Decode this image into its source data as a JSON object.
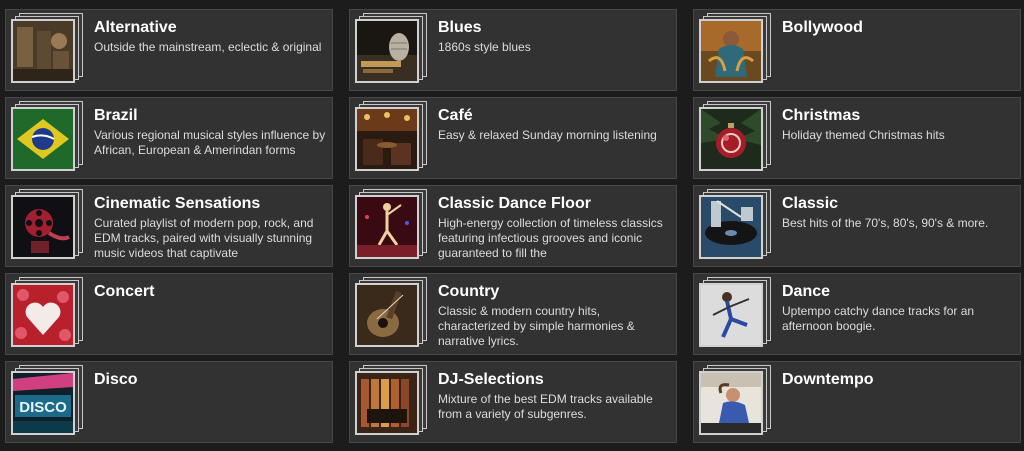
{
  "genres": [
    {
      "title": "Alternative",
      "desc": "Outside the mainstream, eclectic & original",
      "icon": "alternative-art-icon"
    },
    {
      "title": "Blues",
      "desc": "1860s style blues",
      "icon": "microphone-art-icon"
    },
    {
      "title": "Bollywood",
      "desc": "",
      "icon": "dancer-art-icon"
    },
    {
      "title": "Brazil",
      "desc": "Various regional musical styles influence by African, European & Amerindan forms",
      "icon": "brazil-flag-art-icon"
    },
    {
      "title": "Café",
      "desc": "Easy & relaxed Sunday morning listening",
      "icon": "cafe-art-icon"
    },
    {
      "title": "Christmas",
      "desc": "Holiday themed Christmas hits",
      "icon": "ornament-art-icon"
    },
    {
      "title": "Cinematic Sensations",
      "desc": "Curated playlist of modern pop, rock, and EDM tracks, paired with visually stunning music videos that captivate",
      "icon": "film-reel-art-icon"
    },
    {
      "title": "Classic Dance Floor",
      "desc": "High-energy collection of timeless classics featuring infectious grooves and iconic guaranteed to fill the",
      "icon": "dance-floor-art-icon"
    },
    {
      "title": "Classic",
      "desc": "Best hits of the 70's, 80's, 90's & more.",
      "icon": "turntable-art-icon"
    },
    {
      "title": "Concert",
      "desc": "",
      "icon": "heart-roses-art-icon"
    },
    {
      "title": "Country",
      "desc": "Classic & modern country hits, characterized by simple harmonies & narrative lyrics.",
      "icon": "guitar-art-icon"
    },
    {
      "title": "Dance",
      "desc": "Uptempo catchy dance tracks for an afternoon boogie.",
      "icon": "dancer-jump-art-icon"
    },
    {
      "title": "Disco",
      "desc": "",
      "icon": "disco-sign-art-icon"
    },
    {
      "title": "DJ-Selections",
      "desc": "Mixture of the best EDM tracks available from a variety of subgenres.",
      "icon": "dj-art-icon"
    },
    {
      "title": "Downtempo",
      "desc": "",
      "icon": "relaxing-woman-art-icon"
    }
  ],
  "colors": {
    "background": "#1c1c1c",
    "tile": "#323232",
    "tile_border": "#474747",
    "title": "#ffffff",
    "desc": "#dcdcdc"
  }
}
